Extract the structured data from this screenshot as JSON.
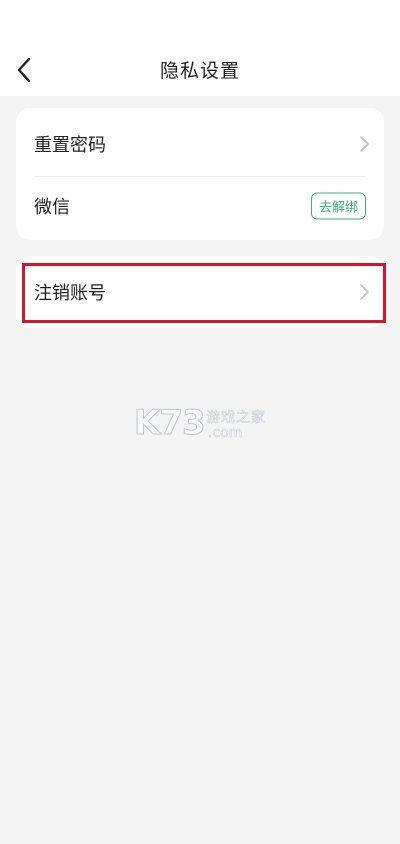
{
  "header": {
    "title": "隐私设置"
  },
  "settings": {
    "reset_password": "重置密码",
    "wechat": "微信",
    "unbind_label": "去解绑",
    "delete_account": "注销账号"
  },
  "watermark": {
    "main": "K73",
    "site_cn": "游戏之家",
    "domain": ".com"
  },
  "colors": {
    "accent_green": "#3fae7a",
    "highlight_red": "#d4162c",
    "background": "#f4f4f4"
  }
}
